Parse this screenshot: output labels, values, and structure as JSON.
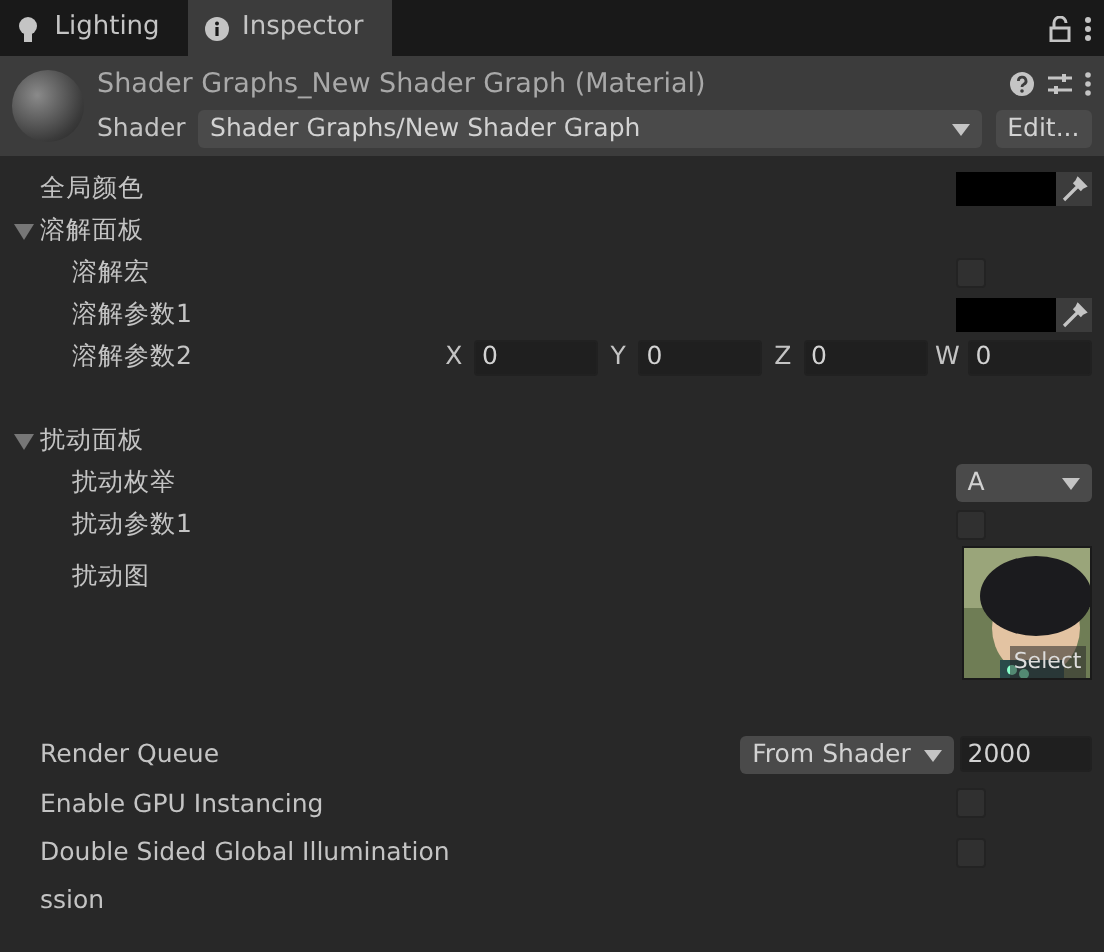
{
  "tabs": [
    {
      "label": "Lighting",
      "selected": false
    },
    {
      "label": "Inspector",
      "selected": true
    }
  ],
  "header": {
    "title": "Shader Graphs_New Shader Graph (Material)",
    "shader_label": "Shader",
    "shader_value": "Shader Graphs/New Shader Graph",
    "edit_button": "Edit..."
  },
  "properties": [
    {
      "kind": "color",
      "label": "全局颜色"
    },
    {
      "kind": "foldout",
      "label": "溶解面板",
      "expanded": true,
      "children": [
        {
          "kind": "toggle",
          "label": "溶解宏",
          "checked": false
        },
        {
          "kind": "color",
          "label": "溶解参数1"
        },
        {
          "kind": "vector4",
          "label": "溶解参数2",
          "components": [
            {
              "axis": "X",
              "value": "0"
            },
            {
              "axis": "Y",
              "value": "0"
            },
            {
              "axis": "Z",
              "value": "0"
            },
            {
              "axis": "W",
              "value": "0"
            }
          ]
        }
      ]
    },
    {
      "kind": "spacer"
    },
    {
      "kind": "foldout",
      "label": "扰动面板",
      "expanded": true,
      "children": [
        {
          "kind": "enum",
          "label": "扰动枚举",
          "value": "A"
        },
        {
          "kind": "toggle",
          "label": "扰动参数1",
          "checked": false
        },
        {
          "kind": "texture",
          "label": "扰动图",
          "select": "Select"
        }
      ]
    }
  ],
  "render_settings": [
    {
      "kind": "queue",
      "label": "Render Queue",
      "mode": "From Shader",
      "value": "2000"
    },
    {
      "kind": "toggle",
      "label": "Enable GPU Instancing",
      "checked": false
    },
    {
      "kind": "toggle",
      "label": "Double Sided Global Illumination",
      "checked": false
    },
    {
      "kind": "text",
      "label": "ssion"
    }
  ]
}
